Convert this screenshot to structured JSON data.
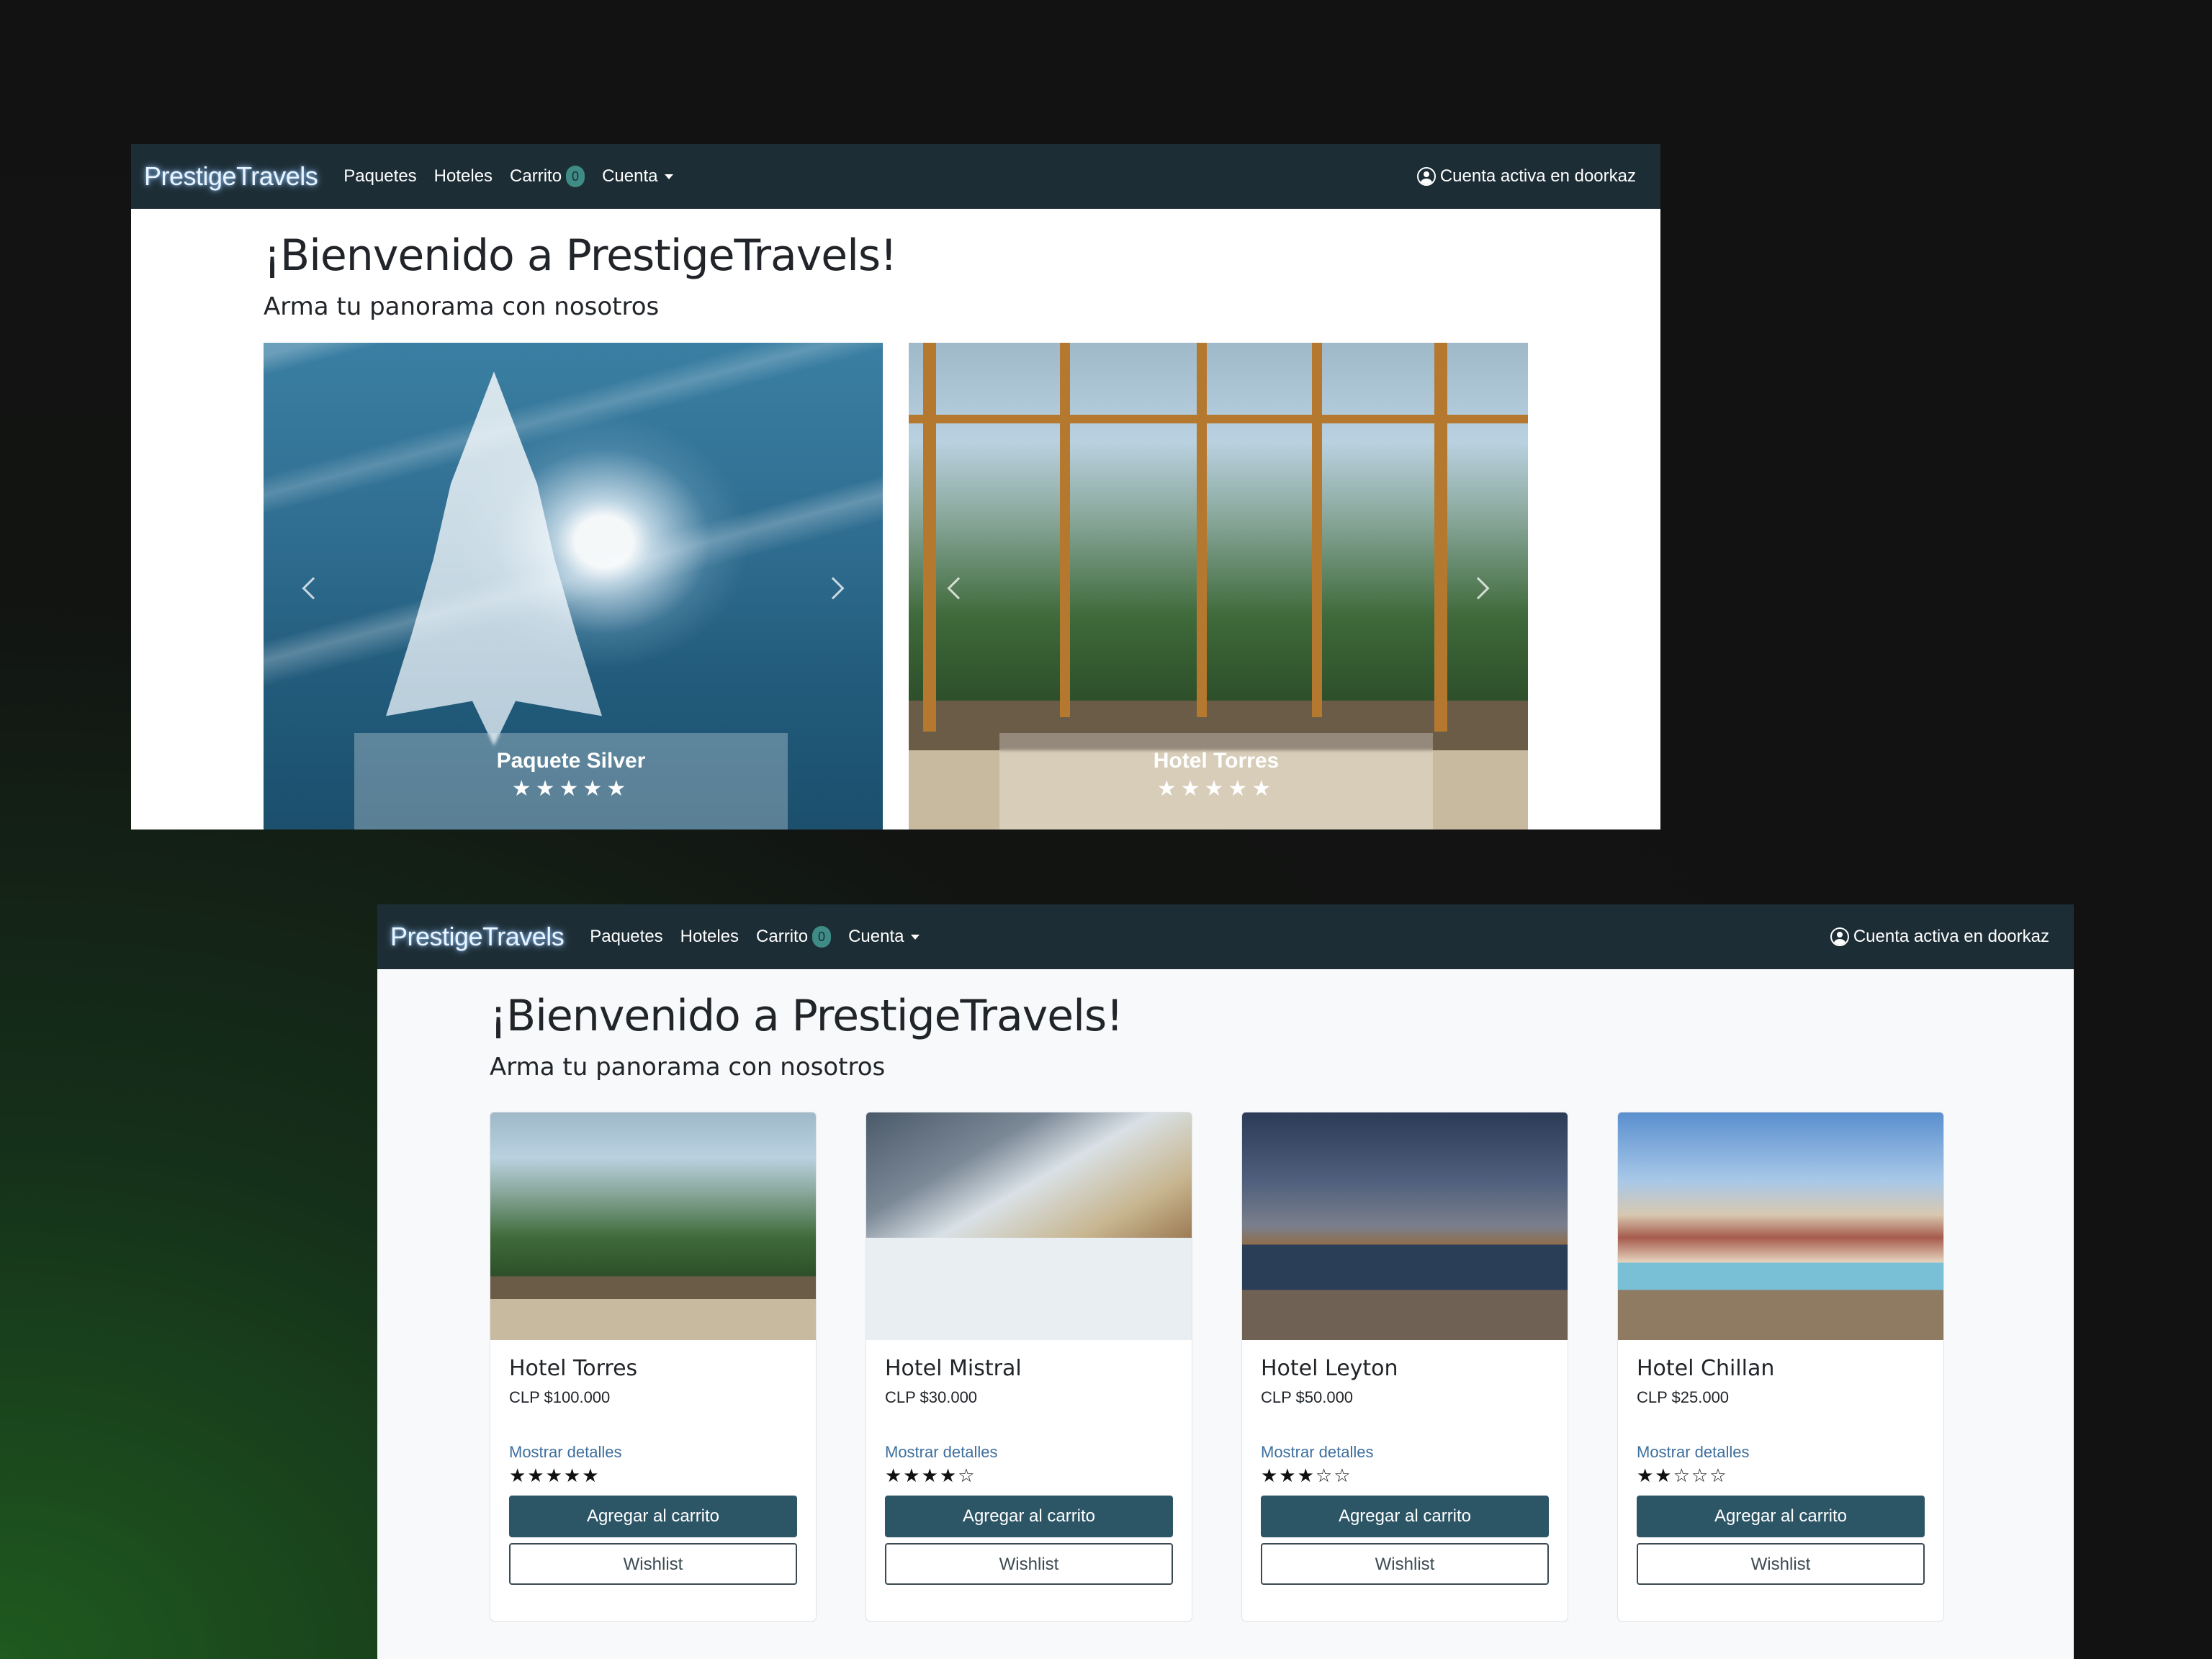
{
  "navbar": {
    "brand": "PrestigeTravels",
    "items": [
      "Paquetes",
      "Hoteles",
      "Carrito",
      "Cuenta"
    ],
    "cart_count": "0",
    "account_status": "Cuenta activa en doorkaz"
  },
  "hero": {
    "title": "¡Bienvenido a PrestigeTravels!",
    "subtitle": "Arma tu panorama con nosotros"
  },
  "carousels": [
    {
      "caption": "Paquete Silver",
      "stars": "★★★★★",
      "rating": 5,
      "slide_count": 10,
      "active_slide": 1
    },
    {
      "caption": "Hotel Torres",
      "stars": "★★★★★",
      "rating": 5,
      "slide_count": 10,
      "active_slide": 1
    }
  ],
  "cards": [
    {
      "name": "Hotel Torres",
      "price": "CLP $100.000",
      "details": "Mostrar detalles",
      "stars": "★★★★★",
      "rating": 5,
      "add_label": "Agregar al carrito",
      "wishlist_label": "Wishlist"
    },
    {
      "name": "Hotel Mistral",
      "price": "CLP $30.000",
      "details": "Mostrar detalles",
      "stars": "★★★★☆",
      "rating": 4,
      "add_label": "Agregar al carrito",
      "wishlist_label": "Wishlist"
    },
    {
      "name": "Hotel Leyton",
      "price": "CLP $50.000",
      "details": "Mostrar detalles",
      "stars": "★★★☆☆",
      "rating": 3,
      "add_label": "Agregar al carrito",
      "wishlist_label": "Wishlist"
    },
    {
      "name": "Hotel Chillan",
      "price": "CLP $25.000",
      "details": "Mostrar detalles",
      "stars": "★★☆☆☆",
      "rating": 2,
      "add_label": "Agregar al carrito",
      "wishlist_label": "Wishlist"
    }
  ],
  "colors": {
    "navbar": "#1d2d35",
    "primary_button": "#2c5566",
    "link": "#3d6f9e",
    "badge": "#3f8b85"
  }
}
